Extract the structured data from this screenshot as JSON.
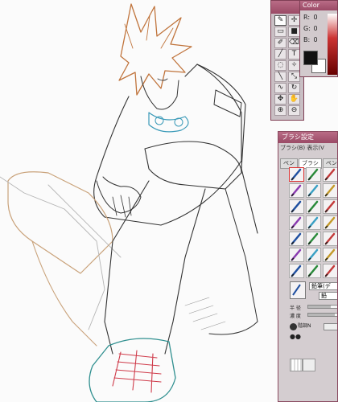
{
  "tool_palette": {
    "tools": [
      {
        "name": "brush-icon",
        "glyph": "✎",
        "selected": true
      },
      {
        "name": "eyedropper-icon",
        "glyph": "✢",
        "selected": false
      },
      {
        "name": "marquee-icon",
        "glyph": "▭",
        "selected": false
      },
      {
        "name": "fill-icon",
        "glyph": "■",
        "selected": false
      },
      {
        "name": "pen-icon",
        "glyph": "✐",
        "selected": false
      },
      {
        "name": "eraser-icon",
        "glyph": "⌫",
        "selected": false
      },
      {
        "name": "line-icon",
        "glyph": "╱",
        "selected": false
      },
      {
        "name": "text-icon",
        "glyph": "T",
        "selected": false
      },
      {
        "name": "lasso-icon",
        "glyph": "◌",
        "selected": false
      },
      {
        "name": "magic-wand-icon",
        "glyph": "✧",
        "selected": false
      },
      {
        "name": "pencil-icon",
        "glyph": "╲",
        "selected": false
      },
      {
        "name": "transform-icon",
        "glyph": "⤡",
        "selected": false
      },
      {
        "name": "curve-icon",
        "glyph": "∿",
        "selected": false
      },
      {
        "name": "rotate-icon",
        "glyph": "↻",
        "selected": false
      },
      {
        "name": "move-icon",
        "glyph": "✥",
        "selected": false
      },
      {
        "name": "hand-icon",
        "glyph": "✋",
        "selected": false
      },
      {
        "name": "zoom-in-icon",
        "glyph": "⊕",
        "selected": false
      },
      {
        "name": "zoom-out-icon",
        "glyph": "⊖",
        "selected": false
      }
    ]
  },
  "color_panel": {
    "title": "Color",
    "r_label": "R:",
    "r_value": "0",
    "g_label": "G:",
    "g_value": "0",
    "b_label": "B:",
    "b_value": "0",
    "foreground_color": "#111111",
    "background_color": "#ffffff"
  },
  "brush_panel": {
    "title": "ブラシ設定",
    "menu": "ブラシ(B)  表示(V",
    "tabs": [
      "ペン",
      "ブラシ",
      "ペン"
    ],
    "active_tab": 1,
    "brush_name": "鉛筆(デ",
    "brush_name_2": "鉛",
    "labels": {
      "size": "半 径",
      "opacity": "濃 度",
      "edge": "階調N"
    },
    "size_level": 0.75,
    "opacity_level": 0.9,
    "accent_colors": [
      "#1f4fa0",
      "#2a8a3a",
      "#c43a3a",
      "#8a3ab0",
      "#3aa0c4",
      "#c49a2a"
    ]
  },
  "drawing": {
    "description_alt": "line art"
  }
}
